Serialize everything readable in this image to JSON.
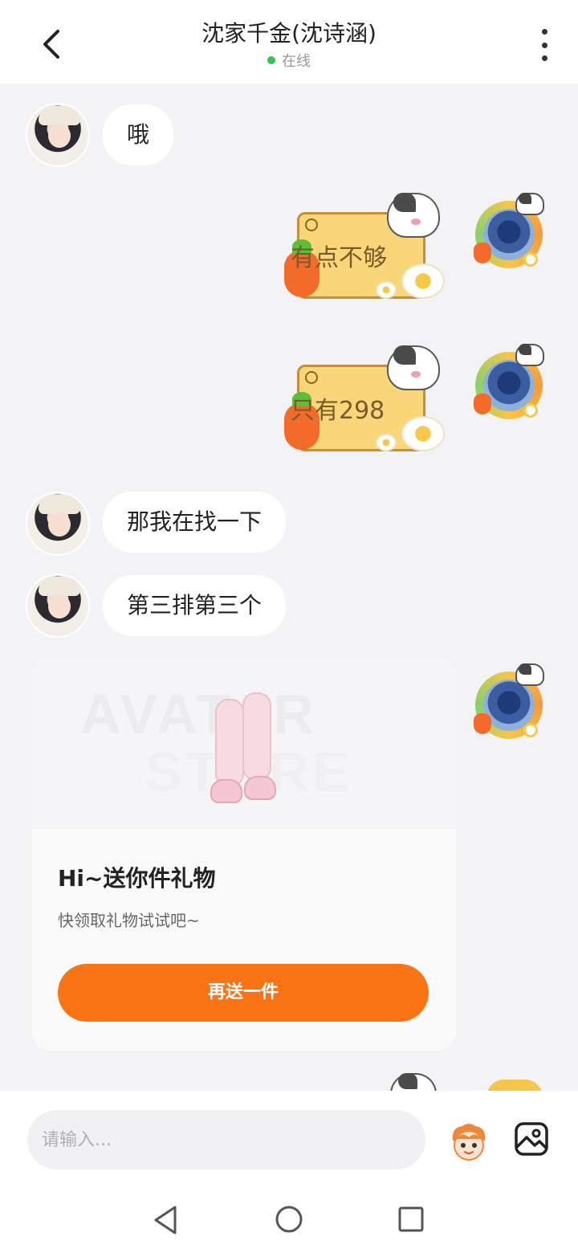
{
  "header": {
    "title": "沈家千金(沈诗涵)",
    "status": "在线"
  },
  "messages": [
    {
      "side": "left",
      "type": "text",
      "text": "哦"
    },
    {
      "side": "right",
      "type": "sticker",
      "text": "有点不够"
    },
    {
      "side": "right",
      "type": "sticker",
      "text": "只有298"
    },
    {
      "side": "left",
      "type": "text",
      "text": "那我在找一下"
    },
    {
      "side": "left",
      "type": "text",
      "text": "第三排第三个"
    }
  ],
  "gift_card": {
    "watermark_line1": "AVATAR",
    "watermark_line2": "STORE",
    "title": "Hi~送你件礼物",
    "subtitle": "快领取礼物试试吧~",
    "button_label": "再送一件"
  },
  "input": {
    "placeholder": "请输入..."
  },
  "icons": {
    "back": "back-arrow-icon",
    "more": "more-vertical-icon",
    "mascot": "mascot-emoji-icon",
    "image": "image-icon",
    "nav_back": "triangle-back-icon",
    "nav_home": "circle-home-icon",
    "nav_recent": "square-recent-icon"
  },
  "colors": {
    "accent": "#fa7314",
    "online": "#31c451",
    "background": "#f3f3f5"
  }
}
